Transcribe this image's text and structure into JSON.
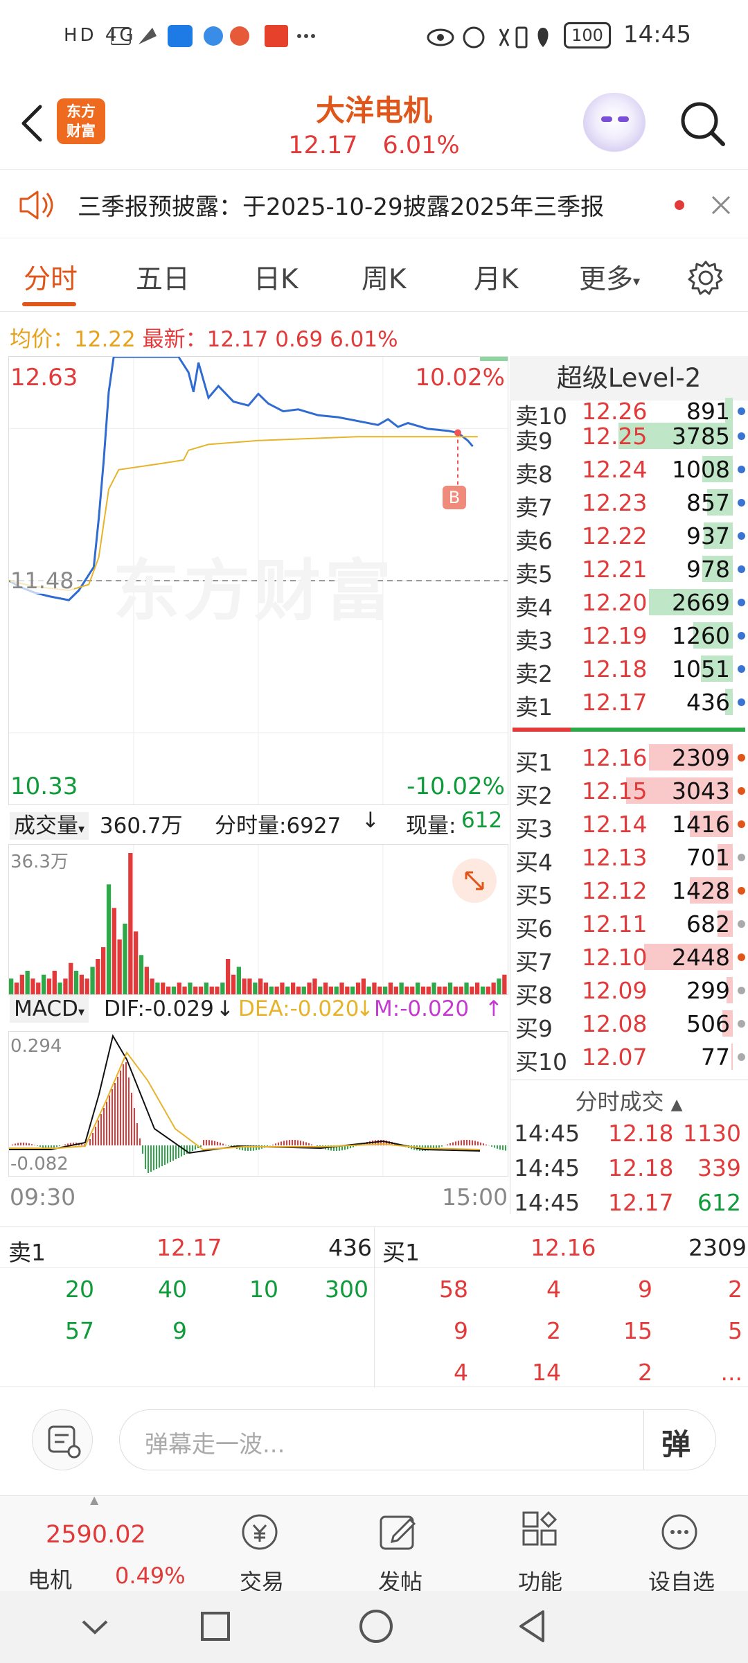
{
  "status_bar": {
    "left_icons": "HD 4G",
    "right_text": "100",
    "time": "14:45"
  },
  "header": {
    "title": "大洋电机",
    "price": "12.17",
    "change_pct": "6.01%",
    "logo_line1": "东方",
    "logo_line2": "财富"
  },
  "notice": {
    "text": "三季报预披露：于2025-10-29披露2025年三季报"
  },
  "tabs": [
    "分时",
    "五日",
    "日K",
    "周K",
    "月K",
    "更多"
  ],
  "info": {
    "avg_label": "均价：",
    "avg_value": "12.22",
    "latest_label": "最新：",
    "latest_value": "12.17",
    "change": "0.69",
    "change_pct": "6.01%"
  },
  "chart_data": [
    {
      "type": "line",
      "title": "",
      "y_top_label": "12.63",
      "y_mid_label": "11.48",
      "y_bottom_label": "10.33",
      "pct_top": "10.02%",
      "pct_bottom": "-10.02%",
      "ylim": [
        10.33,
        12.63
      ],
      "reference": 11.48,
      "x_start": "09:30",
      "x_end": "15:00",
      "watermark": "东方财富",
      "marker": "B",
      "series": [
        {
          "name": "price",
          "color": "#2f6bd1",
          "x": [
            0,
            0.02,
            0.05,
            0.08,
            0.12,
            0.14,
            0.17,
            0.18,
            0.19,
            0.2,
            0.21,
            0.22,
            0.24,
            0.26,
            0.3,
            0.34,
            0.36,
            0.37,
            0.38,
            0.4,
            0.42,
            0.45,
            0.48,
            0.5,
            0.52,
            0.55,
            0.58,
            0.62,
            0.66,
            0.7,
            0.74,
            0.76,
            0.78,
            0.8,
            0.84,
            0.88,
            0.9,
            0.92,
            0.93
          ],
          "y": [
            11.48,
            11.45,
            11.42,
            11.4,
            11.38,
            11.43,
            11.55,
            11.8,
            12.1,
            12.45,
            12.63,
            12.63,
            12.63,
            12.63,
            12.63,
            12.63,
            12.55,
            12.45,
            12.6,
            12.42,
            12.48,
            12.4,
            12.38,
            12.44,
            12.39,
            12.35,
            12.36,
            12.33,
            12.32,
            12.3,
            12.28,
            12.31,
            12.27,
            12.29,
            12.26,
            12.25,
            12.24,
            12.2,
            12.17
          ]
        },
        {
          "name": "avg",
          "color": "#e6b32a",
          "x": [
            0,
            0.05,
            0.12,
            0.16,
            0.18,
            0.2,
            0.22,
            0.3,
            0.35,
            0.36,
            0.4,
            0.5,
            0.6,
            0.7,
            0.8,
            0.9,
            0.94
          ],
          "y": [
            11.48,
            11.45,
            11.43,
            11.46,
            11.6,
            11.95,
            12.05,
            12.08,
            12.1,
            12.15,
            12.18,
            12.2,
            12.21,
            12.22,
            12.22,
            12.22,
            12.22
          ]
        }
      ]
    },
    {
      "type": "bar",
      "title": "",
      "label": "成交量",
      "total": "360.7万",
      "tick_label": "分时量:6927",
      "current_label": "现量:",
      "current_value": "612",
      "ylim_label": "36.3万",
      "values": [
        4,
        3,
        5,
        6,
        4,
        3,
        5,
        4,
        6,
        3,
        4,
        8,
        6,
        5,
        4,
        7,
        9,
        12,
        28,
        22,
        14,
        18,
        36,
        16,
        10,
        7,
        4,
        3,
        3,
        2,
        2,
        3,
        2,
        3,
        2,
        2,
        3,
        2,
        2,
        3,
        9,
        5,
        7,
        4,
        4,
        3,
        4,
        3,
        2,
        2,
        3,
        2,
        3,
        2,
        2,
        3,
        4,
        2,
        3,
        2,
        2,
        3,
        2,
        2,
        3,
        4,
        2,
        3,
        2,
        2,
        3,
        2,
        3,
        2,
        2,
        3,
        2,
        2,
        3,
        2,
        2,
        3,
        2,
        2,
        3,
        2,
        3,
        2,
        2,
        3,
        4,
        5
      ]
    },
    {
      "type": "line",
      "title": "",
      "label": "MACD",
      "dif_label": "DIF:-0.029",
      "dea_label": "DEA:-0.020",
      "m_label": "M:-0.020",
      "ylim_labels": [
        "0.294",
        "-0.082"
      ],
      "ylim": [
        -0.082,
        0.294
      ]
    }
  ],
  "orderbook": {
    "title": "超级Level-2",
    "sell": [
      {
        "name": "卖10",
        "price": "12.26",
        "vol": "891",
        "bar": 0.05
      },
      {
        "name": "卖9",
        "price": "12.25",
        "vol": "3785",
        "bar": 0.75
      },
      {
        "name": "卖8",
        "price": "12.24",
        "vol": "1008",
        "bar": 0.2
      },
      {
        "name": "卖7",
        "price": "12.23",
        "vol": "857",
        "bar": 0.17
      },
      {
        "name": "卖6",
        "price": "12.22",
        "vol": "937",
        "bar": 0.19
      },
      {
        "name": "卖5",
        "price": "12.21",
        "vol": "978",
        "bar": 0.2
      },
      {
        "name": "卖4",
        "price": "12.20",
        "vol": "2669",
        "bar": 0.55
      },
      {
        "name": "卖3",
        "price": "12.19",
        "vol": "1260",
        "bar": 0.26
      },
      {
        "name": "卖2",
        "price": "12.18",
        "vol": "1051",
        "bar": 0.21
      },
      {
        "name": "卖1",
        "price": "12.17",
        "vol": "436",
        "bar": 0.05
      }
    ],
    "buy": [
      {
        "name": "买1",
        "price": "12.16",
        "vol": "2309",
        "bar": 0.55
      },
      {
        "name": "买2",
        "price": "12.15",
        "vol": "3043",
        "bar": 0.7
      },
      {
        "name": "买3",
        "price": "12.14",
        "vol": "1416",
        "bar": 0.28
      },
      {
        "name": "买4",
        "price": "12.13",
        "vol": "701",
        "bar": 0.1
      },
      {
        "name": "买5",
        "price": "12.12",
        "vol": "1428",
        "bar": 0.28
      },
      {
        "name": "买6",
        "price": "12.11",
        "vol": "682",
        "bar": 0.1
      },
      {
        "name": "买7",
        "price": "12.10",
        "vol": "2448",
        "bar": 0.58
      },
      {
        "name": "买8",
        "price": "12.09",
        "vol": "299",
        "bar": 0.04
      },
      {
        "name": "买9",
        "price": "12.08",
        "vol": "506",
        "bar": 0.07
      },
      {
        "name": "买10",
        "price": "12.07",
        "vol": "77",
        "bar": 0.01
      }
    ],
    "trades_title": "分时成交",
    "trades": [
      {
        "time": "14:45",
        "price": "12.18",
        "vol": "1130"
      },
      {
        "time": "14:45",
        "price": "12.18",
        "vol": "339"
      },
      {
        "time": "14:45",
        "price": "12.17",
        "vol": "612"
      }
    ]
  },
  "queue": {
    "sell_label": "卖1",
    "sell_price": "12.17",
    "sell_vol": "436",
    "buy_label": "买1",
    "buy_price": "12.16",
    "buy_vol": "2309",
    "sell_items": [
      "20",
      "40",
      "10",
      "300",
      "57",
      "9"
    ],
    "buy_items": [
      "58",
      "4",
      "9",
      "2",
      "9",
      "2",
      "15",
      "5",
      "4",
      "14",
      "2",
      "..."
    ]
  },
  "danmaku": {
    "placeholder": "弹幕走一波...",
    "button": "弹"
  },
  "bottom_nav": {
    "index_value": "2590.02",
    "index_name": "电机",
    "index_pct": "0.49%",
    "items": [
      "交易",
      "发帖",
      "功能",
      "设自选"
    ]
  }
}
